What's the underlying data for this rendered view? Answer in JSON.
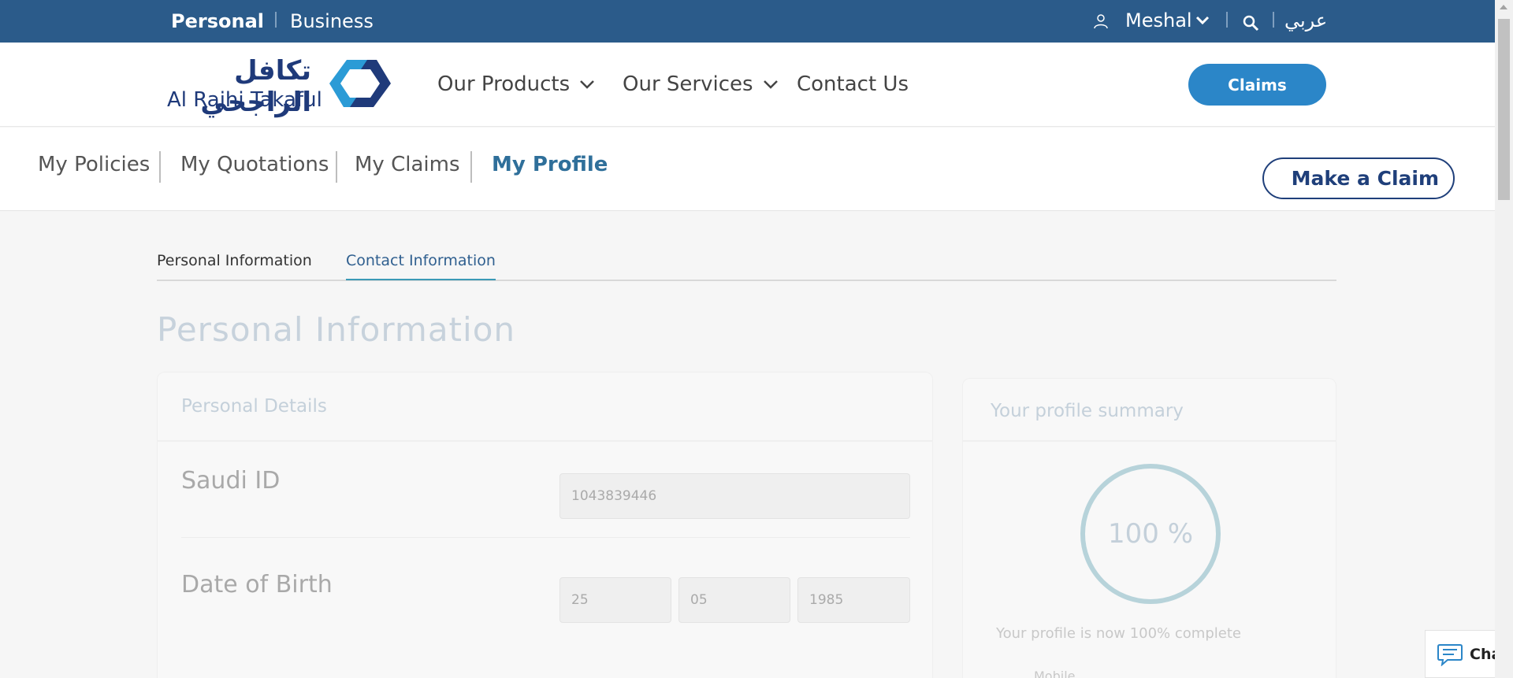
{
  "topbar": {
    "segment_personal": "Personal",
    "segment_business": "Business",
    "user_name": "Meshal",
    "language": "عربي"
  },
  "header": {
    "logo_arabic": "تكافل الراجحي",
    "logo_english": "Al Rajhi Takaful",
    "nav": {
      "products": "Our Products",
      "services": "Our Services",
      "contact": "Contact Us"
    },
    "claims_label": "Claims"
  },
  "subnav": {
    "policies": "My Policies",
    "quotations": "My Quotations",
    "claims": "My Claims",
    "profile": "My Profile",
    "make_claim": "Make a Claim"
  },
  "tabs": {
    "personal": "Personal Information",
    "contact": "Contact Information",
    "active": "Contact Information"
  },
  "profile": {
    "heading": "Personal Information",
    "details_title": "Personal Details",
    "saudi_id_label": "Saudi ID",
    "saudi_id_value": "1043839446",
    "dob_label": "Date of Birth",
    "dob_day": "25",
    "dob_month": "05",
    "dob_year": "1985"
  },
  "summary": {
    "title": "Your profile summary",
    "percent_text": "100 %",
    "percent_value": 100,
    "status_text": "Your profile is now 100% complete",
    "item_mobile": "Mobile"
  },
  "chat": {
    "label": "Chat"
  },
  "colors": {
    "topbar": "#2b5b8a",
    "accent_blue": "#2b86c8",
    "navy": "#1f3f7a",
    "tab_underline": "#3b9ab6"
  }
}
